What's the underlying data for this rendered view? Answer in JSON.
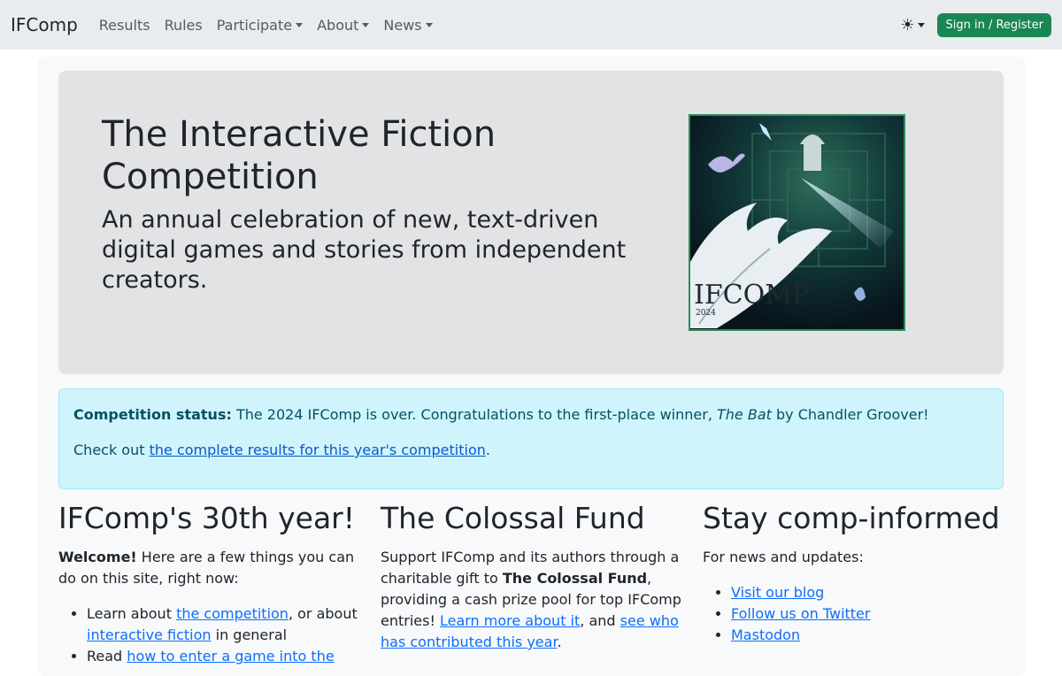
{
  "nav": {
    "brand": "IFComp",
    "links": [
      "Results",
      "Rules",
      "Participate",
      "About",
      "News"
    ],
    "theme_icon": "sun-icon",
    "signin_label": "Sign in / Register"
  },
  "hero": {
    "title": "The Interactive Fiction Competition",
    "subtitle": "An annual celebration of new, text-driven digital games and stories from independent creators.",
    "image": {
      "logo_text": "IFCOMP",
      "year": "2024"
    }
  },
  "status": {
    "label": "Competition status:",
    "text_before": " The 2024 IFComp is over. Congratulations to the first-place winner, ",
    "winner_title": "The Bat",
    "text_after": " by Chandler Groover!",
    "results_prefix": "Check out ",
    "results_link": "the complete results for this year's competition",
    "results_suffix": "."
  },
  "col1": {
    "heading": "IFComp's 30th year!",
    "welcome_bold": "Welcome!",
    "welcome_text": " Here are a few things you can do on this site, right now:",
    "item1_prefix": "Learn about ",
    "item1_link1": "the competition",
    "item1_mid": ", or about ",
    "item1_link2": "interactive fiction",
    "item1_suffix": " in general",
    "item2_prefix": "Read ",
    "item2_link": "how to enter a game into the"
  },
  "col2": {
    "heading": "The Colossal Fund",
    "text1": "Support IFComp and its authors through a charitable gift to ",
    "bold": "The Colossal Fund",
    "text2": ", providing a cash prize pool for top IFComp entries! ",
    "link1": "Learn more about it",
    "text3": ", and ",
    "link2": "see who has contributed this year",
    "text4": "."
  },
  "col3": {
    "heading": "Stay comp-informed",
    "intro": "For news and updates:",
    "links": [
      "Visit our blog",
      "Follow us on Twitter",
      "Mastodon"
    ]
  }
}
